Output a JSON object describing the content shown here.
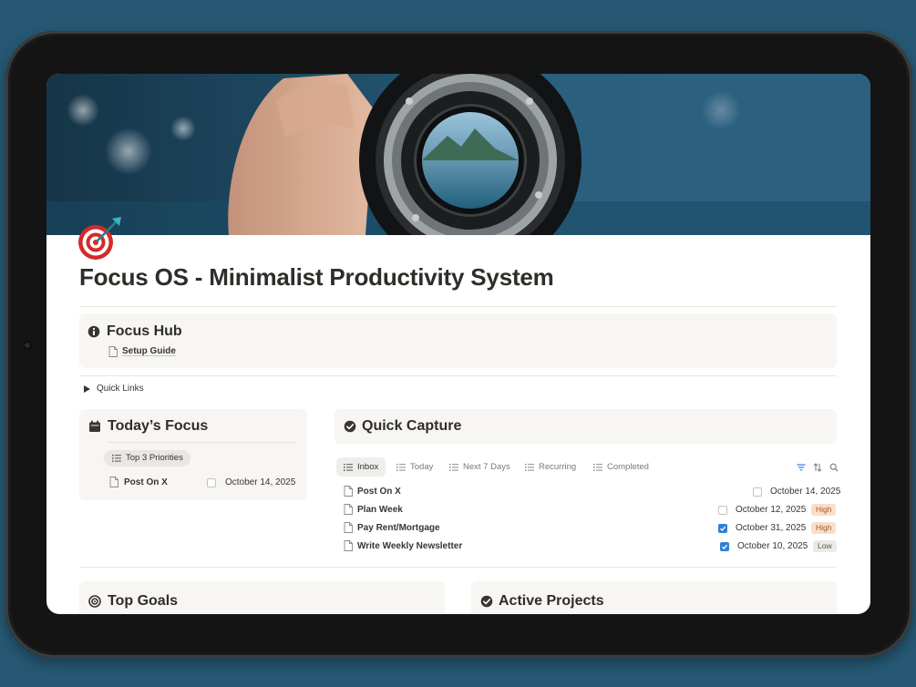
{
  "page": {
    "title": "Focus OS - Minimalist Productivity System",
    "icon": "dart-target-icon"
  },
  "focus_hub": {
    "title": "Focus Hub",
    "icon": "info-circle-icon",
    "link": "Setup Guide"
  },
  "quick_links": {
    "label": "Quick Links",
    "expanded": false
  },
  "todays_focus": {
    "title": "Today’s Focus",
    "icon": "calendar-icon",
    "view_label": "Top 3 Priorities",
    "items": [
      {
        "title": "Post On X",
        "checked": false,
        "date": "October 14, 2025"
      }
    ]
  },
  "quick_capture": {
    "title": "Quick Capture",
    "icon": "check-circle-icon",
    "tabs": [
      "Inbox",
      "Today",
      "Next 7 Days",
      "Recurring",
      "Completed"
    ],
    "active_tab": "Inbox",
    "tool_icons": [
      "filter-icon",
      "sort-icon",
      "search-icon"
    ],
    "items": [
      {
        "title": "Post On X",
        "checked": false,
        "date": "October 14, 2025",
        "priority": ""
      },
      {
        "title": "Plan Week",
        "checked": false,
        "date": "October 12, 2025",
        "priority": "High"
      },
      {
        "title": "Pay Rent/Mortgage",
        "checked": true,
        "date": "October 31, 2025",
        "priority": "High"
      },
      {
        "title": "Write Weekly Newsletter",
        "checked": true,
        "date": "October 10, 2025",
        "priority": "Low"
      }
    ]
  },
  "top_goals": {
    "title": "Top Goals",
    "icon": "target-icon"
  },
  "active_projects": {
    "title": "Active Projects",
    "icon": "check-circle-icon"
  },
  "colors": {
    "background": "#265873",
    "checkbox_checked": "#2f80d8",
    "tag_high_bg": "#fadec9",
    "tag_high_text": "#a9572b",
    "tag_low_bg": "#ebeae6",
    "callout_bg": "#f7f6f3"
  }
}
